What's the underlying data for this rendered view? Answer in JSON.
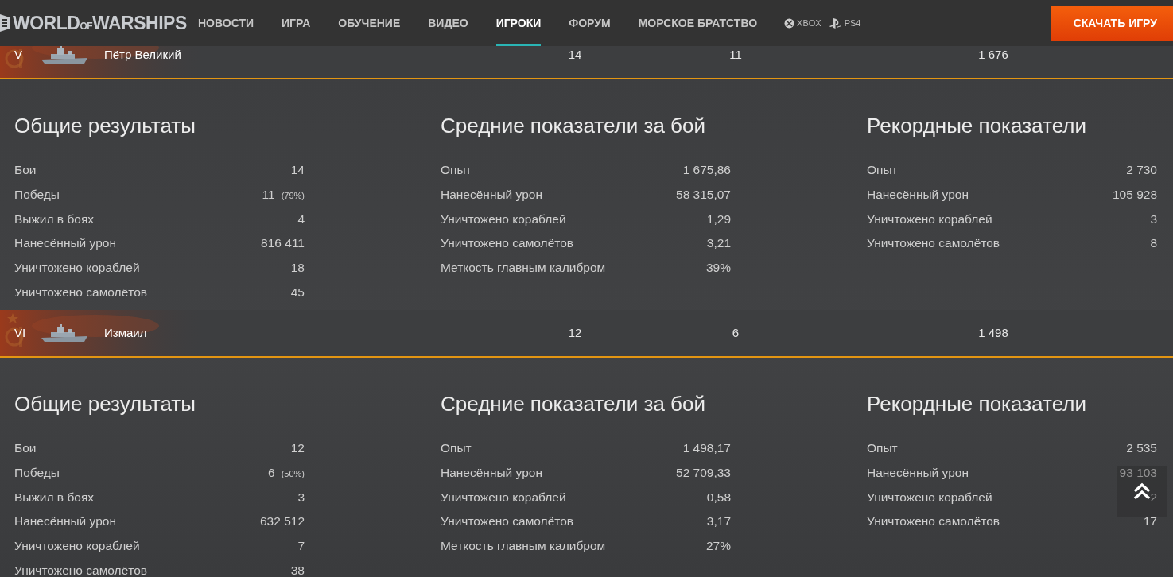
{
  "header": {
    "logo": [
      "WORLD",
      "OF",
      "WARSHIPS"
    ],
    "nav": [
      {
        "label": "НОВОСТИ",
        "selected": false
      },
      {
        "label": "ИГРА",
        "selected": false
      },
      {
        "label": "ОБУЧЕНИЕ",
        "selected": false
      },
      {
        "label": "ВИДЕО",
        "selected": false
      },
      {
        "label": "ИГРОКИ",
        "selected": true
      },
      {
        "label": "ФОРУМ",
        "selected": false
      },
      {
        "label": "МОРСКОЕ БРАТСТВО",
        "selected": false
      }
    ],
    "platforms": [
      {
        "kind": "xbox",
        "label": "XBOX"
      },
      {
        "kind": "ps",
        "label": "PS4"
      }
    ],
    "download_button": "СКАЧАТЬ ИГРУ"
  },
  "ships": [
    {
      "tier": "V",
      "name": "Пётр Великий",
      "battles": "14",
      "wins": "11",
      "avg_exp": "1 676",
      "sections": [
        {
          "title": "Общие результаты",
          "rows": [
            {
              "label": "Бои",
              "value": "14"
            },
            {
              "label": "Победы",
              "value": "11",
              "percent": "(79%)"
            },
            {
              "label": "Выжил в боях",
              "value": "4"
            },
            {
              "label": "Нанесённый урон",
              "value": "816 411"
            },
            {
              "label": "Уничтожено кораблей",
              "value": "18"
            },
            {
              "label": "Уничтожено самолётов",
              "value": "45"
            }
          ]
        },
        {
          "title": "Средние показатели за бой",
          "rows": [
            {
              "label": "Опыт",
              "value": "1 675,86"
            },
            {
              "label": "Нанесённый урон",
              "value": "58 315,07"
            },
            {
              "label": "Уничтожено кораблей",
              "value": "1,29"
            },
            {
              "label": "Уничтожено самолётов",
              "value": "3,21"
            },
            {
              "label": "Меткость главным калибром",
              "value": "39%"
            }
          ]
        },
        {
          "title": "Рекордные показатели",
          "rows": [
            {
              "label": "Опыт",
              "value": "2 730"
            },
            {
              "label": "Нанесённый урон",
              "value": "105 928"
            },
            {
              "label": "Уничтожено кораблей",
              "value": "3"
            },
            {
              "label": "Уничтожено самолётов",
              "value": "8"
            }
          ]
        }
      ]
    },
    {
      "tier": "VI",
      "name": "Измаил",
      "battles": "12",
      "wins": "6",
      "avg_exp": "1 498",
      "sections": [
        {
          "title": "Общие результаты",
          "rows": [
            {
              "label": "Бои",
              "value": "12"
            },
            {
              "label": "Победы",
              "value": "6",
              "percent": "(50%)"
            },
            {
              "label": "Выжил в боях",
              "value": "3"
            },
            {
              "label": "Нанесённый урон",
              "value": "632 512"
            },
            {
              "label": "Уничтожено кораблей",
              "value": "7"
            },
            {
              "label": "Уничтожено самолётов",
              "value": "38"
            }
          ]
        },
        {
          "title": "Средние показатели за бой",
          "rows": [
            {
              "label": "Опыт",
              "value": "1 498,17"
            },
            {
              "label": "Нанесённый урон",
              "value": "52 709,33"
            },
            {
              "label": "Уничтожено кораблей",
              "value": "0,58"
            },
            {
              "label": "Уничтожено самолётов",
              "value": "3,17"
            },
            {
              "label": "Меткость главным калибром",
              "value": "27%"
            }
          ]
        },
        {
          "title": "Рекордные показатели",
          "rows": [
            {
              "label": "Опыт",
              "value": "2 535"
            },
            {
              "label": "Нанесённый урон",
              "value": "93 103"
            },
            {
              "label": "Уничтожено кораблей",
              "value": "2"
            },
            {
              "label": "Уничтожено самолётов",
              "value": "17"
            }
          ]
        }
      ]
    }
  ]
}
